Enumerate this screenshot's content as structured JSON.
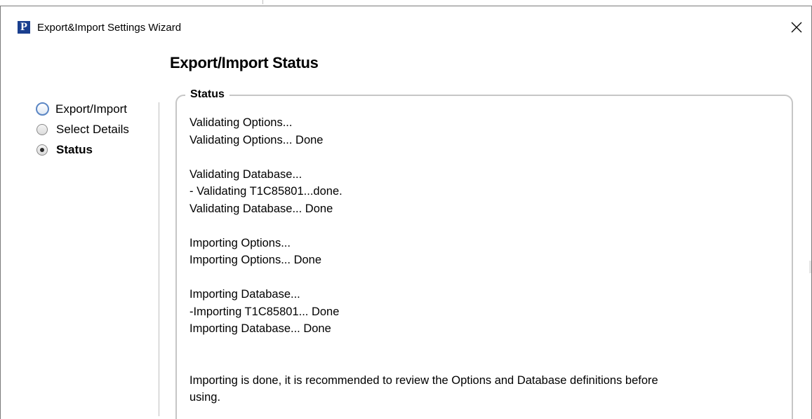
{
  "window": {
    "title": "Export&Import Settings Wizard",
    "icon_letter": "P",
    "close_symbol": "✕"
  },
  "heading": "Export/Import Status",
  "steps": [
    {
      "label": "Export/Import",
      "state": "unselected-hover"
    },
    {
      "label": "Select Details",
      "state": "unselected"
    },
    {
      "label": "Status",
      "state": "selected"
    }
  ],
  "status_group": {
    "legend": "Status",
    "log_lines": [
      "Validating Options...",
      "Validating Options... Done",
      "",
      "Validating Database...",
      "- Validating T1C85801...done.",
      "Validating Database... Done",
      "",
      "Importing Options...",
      "Importing Options... Done",
      "",
      "Importing Database...",
      "-Importing T1C85801... Done",
      "Importing Database... Done",
      "",
      "",
      "Importing is done, it is recommended to review the Options and Database definitions before",
      "using."
    ]
  },
  "colors": {
    "icon_background": "#1a3f8f",
    "radio_hover_border": "#5b86c4",
    "group_border": "#c6c6c6"
  }
}
